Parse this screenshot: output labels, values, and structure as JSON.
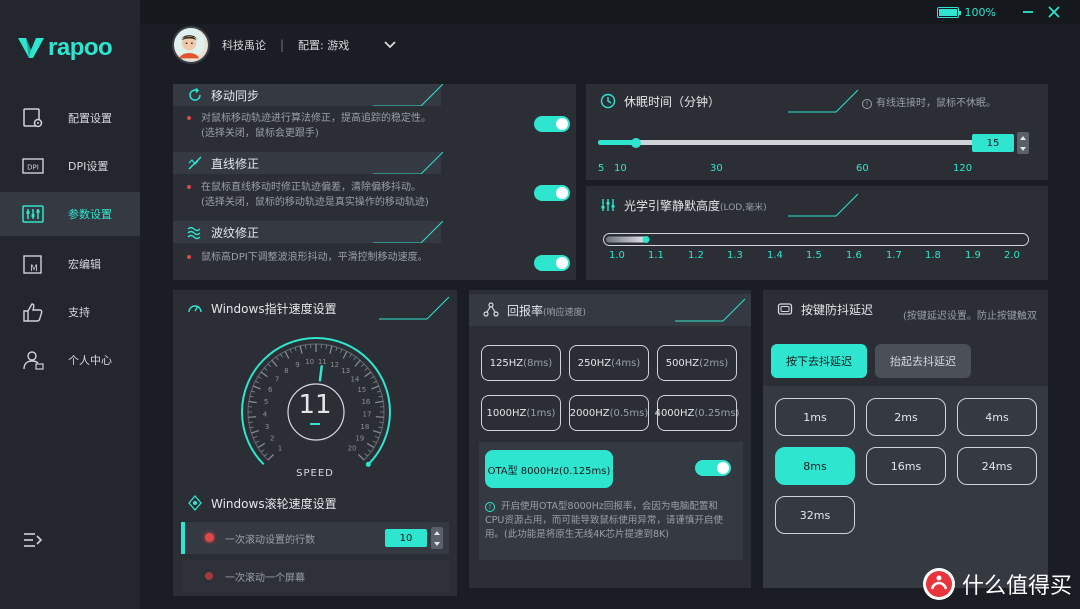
{
  "brand": {
    "name": "rapoo"
  },
  "window": {
    "battery_pct": "100%"
  },
  "profile": {
    "user": "科技禹论",
    "separator": "|",
    "config": "配置: 游戏"
  },
  "nav": [
    {
      "label": "配置设置",
      "icon": "config-icon"
    },
    {
      "label": "DPI设置",
      "icon": "dpi-icon"
    },
    {
      "label": "参数设置",
      "icon": "params-icon",
      "active": true
    },
    {
      "label": "宏编辑",
      "icon": "macro-icon"
    },
    {
      "label": "支持",
      "icon": "thumbs-up-icon"
    },
    {
      "label": "个人中心",
      "icon": "user-icon"
    }
  ],
  "motion_sync": {
    "title": "移动同步",
    "desc1": "对鼠标移动轨迹进行算法修正，提高追踪的稳定性。",
    "desc2": "(选择关闭，鼠标会更跟手)",
    "enabled": true
  },
  "angle_snap": {
    "title": "直线修正",
    "desc1": "在鼠标直线移动时修正轨迹偏差，清除偏移抖动。",
    "desc2": "(选择关闭，鼠标的移动轨迹是真实操作的移动轨迹)",
    "enabled": true
  },
  "ripple": {
    "title": "波纹修正",
    "desc1": "鼠标高DPI下调整波浪形抖动，平滑控制移动速度。",
    "enabled": true
  },
  "sleep": {
    "title": "休眠时间（分钟）",
    "hint": "有线连接时，鼠标不休眠。",
    "value": "15",
    "ticks": [
      "5",
      "10",
      "30",
      "60",
      "120"
    ]
  },
  "lod": {
    "title": "光学引擎静默高度",
    "unit": "(LOD,毫米)",
    "value": 1.1,
    "ticks": [
      "1.0",
      "1.1",
      "1.2",
      "1.3",
      "1.4",
      "1.5",
      "1.6",
      "1.7",
      "1.8",
      "1.9",
      "2.0"
    ]
  },
  "pointer": {
    "title": "Windows指针速度设置",
    "value": "11",
    "label": "SPEED",
    "dial_numbers": [
      "1",
      "2",
      "3",
      "4",
      "5",
      "6",
      "7",
      "8",
      "9",
      "10",
      "11",
      "12",
      "13",
      "14",
      "15",
      "16",
      "17",
      "18",
      "19",
      "20"
    ]
  },
  "scroll": {
    "title": "Windows滚轮速度设置",
    "option1": "一次滚动设置的行数",
    "option1_value": "10",
    "option2": "一次滚动一个屏幕"
  },
  "polling": {
    "title": "回报率",
    "title_sub": "(响应速度)",
    "rates": [
      {
        "hz": "125HZ",
        "ms": "(8ms)"
      },
      {
        "hz": "250HZ",
        "ms": "(4ms)"
      },
      {
        "hz": "500HZ",
        "ms": "(2ms)"
      },
      {
        "hz": "1000HZ",
        "ms": "(1ms)"
      },
      {
        "hz": "2000HZ",
        "ms": "(0.5ms)"
      },
      {
        "hz": "4000HZ",
        "ms": "(0.25ms)"
      }
    ],
    "ota_label": "OTA型 8000Hz(0.125ms)",
    "ota_enabled": true,
    "note": "开启使用OTA型8000Hz回报率，会因为电脑配置和CPU资源占用，而可能导致鼠标使用异常，请谨慎开启使用。(此功能是将原生无线4K芯片提速到8K)"
  },
  "debounce": {
    "title": "按键防抖延迟",
    "hint": "(按键延迟设置。防止按键触双",
    "mode_press": "按下去抖延迟",
    "mode_release": "抬起去抖延迟",
    "values": [
      "1ms",
      "2ms",
      "4ms",
      "8ms",
      "16ms",
      "24ms",
      "32ms"
    ],
    "selected": "8ms"
  },
  "watermark": {
    "text": "什么值得买"
  },
  "colors": {
    "accent": "#2ee6d0",
    "panel": "#2b2e35",
    "sidebar": "#23262d",
    "danger": "#e04848"
  }
}
